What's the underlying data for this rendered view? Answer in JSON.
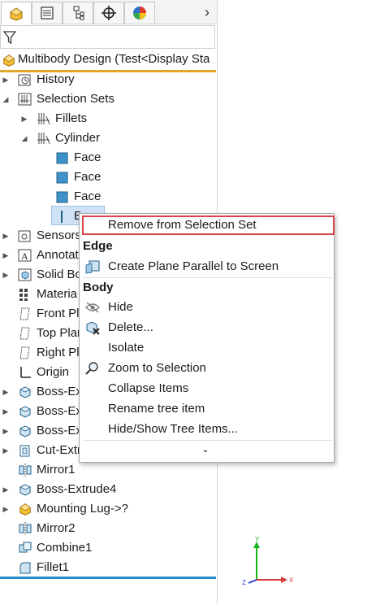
{
  "tabs": [
    {
      "name": "feature-manager-tab",
      "icon": "feature-manager-icon",
      "active": true
    },
    {
      "name": "property-manager-tab",
      "icon": "property-manager-icon",
      "active": false
    },
    {
      "name": "configuration-manager-tab",
      "icon": "configuration-manager-icon",
      "active": false
    },
    {
      "name": "dimxpert-tab",
      "icon": "crosshair-icon",
      "active": false
    },
    {
      "name": "display-manager-tab",
      "icon": "display-manager-icon",
      "active": false
    }
  ],
  "tab_more": "›",
  "root": {
    "label": "Multibody Design  (Test<Display Sta"
  },
  "tree": {
    "history": "History",
    "selection_sets": "Selection Sets",
    "fillets": "Fillets",
    "cylinder": "Cylinder",
    "face1": "Face",
    "face2": "Face",
    "face3": "Face",
    "edge": "Edge",
    "sensors": "Sensors",
    "annotations": "Annotat",
    "solid_bodies": "Solid Bo",
    "material": "Materia",
    "front_plane": "Front Pl",
    "top_plane": "Top Plan",
    "right_plane": "Right Pl",
    "origin": "Origin",
    "boss1": "Boss-Ex",
    "boss2": "Boss-Ex",
    "boss3": "Boss-Ex",
    "cut": "Cut-Extr",
    "mirror1": "Mirror1",
    "boss4": "Boss-Extrude4",
    "mounting_lug": "Mounting Lug->?",
    "mirror2": "Mirror2",
    "combine1": "Combine1",
    "fillet1": "Fillet1"
  },
  "context_menu": {
    "remove": "Remove from Selection Set",
    "edge_header": "Edge",
    "create_plane": "Create Plane Parallel to Screen",
    "body_header": "Body",
    "hide": "Hide",
    "delete": "Delete...",
    "isolate": "Isolate",
    "zoom": "Zoom to Selection",
    "collapse": "Collapse Items",
    "rename": "Rename tree item",
    "hide_show": "Hide/Show Tree Items...",
    "more": "⌄"
  },
  "triad": {
    "y": "Y",
    "x": "X",
    "z": "Z"
  },
  "colors": {
    "accent_orange": "#e0a52d",
    "accent_blue": "#2a8bc8",
    "highlight_red": "#d9424a",
    "selection_blue": "#cfe2f6"
  }
}
